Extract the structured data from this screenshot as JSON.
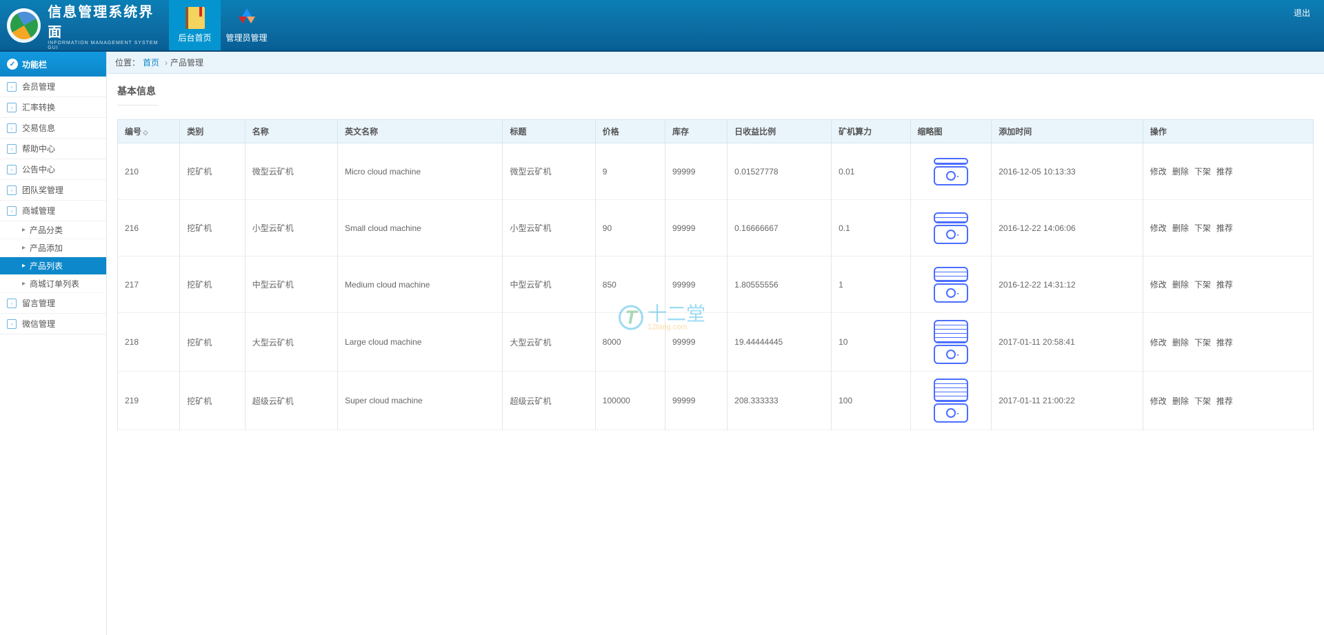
{
  "header": {
    "logo_title": "信息管理系统界面",
    "logo_sub": "INFORMATION MANAGEMENT SYSTEM GUI",
    "nav": [
      {
        "label": "后台首页",
        "active": true
      },
      {
        "label": "管理员管理",
        "active": false
      }
    ],
    "logout": "退出"
  },
  "sidebar": {
    "header": "功能栏",
    "items": [
      {
        "label": "会员管理"
      },
      {
        "label": "汇率转换"
      },
      {
        "label": "交易信息"
      },
      {
        "label": "帮助中心"
      },
      {
        "label": "公告中心"
      },
      {
        "label": "团队奖管理"
      },
      {
        "label": "商城管理",
        "expanded": true,
        "children": [
          {
            "label": "产品分类"
          },
          {
            "label": "产品添加"
          },
          {
            "label": "产品列表",
            "active": true
          },
          {
            "label": "商城订单列表"
          }
        ]
      },
      {
        "label": "留言管理"
      },
      {
        "label": "微信管理"
      }
    ]
  },
  "breadcrumb": {
    "label": "位置：",
    "home": "首页",
    "current": "产品管理"
  },
  "section": {
    "title": "基本信息"
  },
  "table": {
    "columns": [
      "编号",
      "类别",
      "名称",
      "英文名称",
      "标题",
      "价格",
      "库存",
      "日收益比例",
      "矿机算力",
      "缩略图",
      "添加时间",
      "操作"
    ],
    "rows": [
      {
        "id": "210",
        "category": "挖矿机",
        "name": "微型云矿机",
        "en_name": "Micro cloud machine",
        "title": "微型云矿机",
        "price": "9",
        "stock": "99999",
        "daily": "0.01527778",
        "power": "0.01",
        "slots": 1,
        "created": "2016-12-05 10:13:33"
      },
      {
        "id": "216",
        "category": "挖矿机",
        "name": "小型云矿机",
        "en_name": "Small cloud machine",
        "title": "小型云矿机",
        "price": "90",
        "stock": "99999",
        "daily": "0.16666667",
        "power": "0.1",
        "slots": 2,
        "created": "2016-12-22 14:06:06"
      },
      {
        "id": "217",
        "category": "挖矿机",
        "name": "中型云矿机",
        "en_name": "Medium cloud machine",
        "title": "中型云矿机",
        "price": "850",
        "stock": "99999",
        "daily": "1.80555556",
        "power": "1",
        "slots": 3,
        "created": "2016-12-22 14:31:12"
      },
      {
        "id": "218",
        "category": "挖矿机",
        "name": "大型云矿机",
        "en_name": "Large cloud machine",
        "title": "大型云矿机",
        "price": "8000",
        "stock": "99999",
        "daily": "19.44444445",
        "power": "10",
        "slots": 5,
        "created": "2017-01-11 20:58:41"
      },
      {
        "id": "219",
        "category": "挖矿机",
        "name": "超级云矿机",
        "en_name": "Super cloud machine",
        "title": "超级云矿机",
        "price": "100000",
        "stock": "99999",
        "daily": "208.333333",
        "power": "100",
        "slots": 5,
        "created": "2017-01-11 21:00:22"
      }
    ],
    "actions": {
      "edit": "修改",
      "delete": "删除",
      "off": "下架",
      "recommend": "推荐"
    }
  },
  "watermark": {
    "brand": "十二堂",
    "url": "12tang.com",
    "letter": "T"
  }
}
